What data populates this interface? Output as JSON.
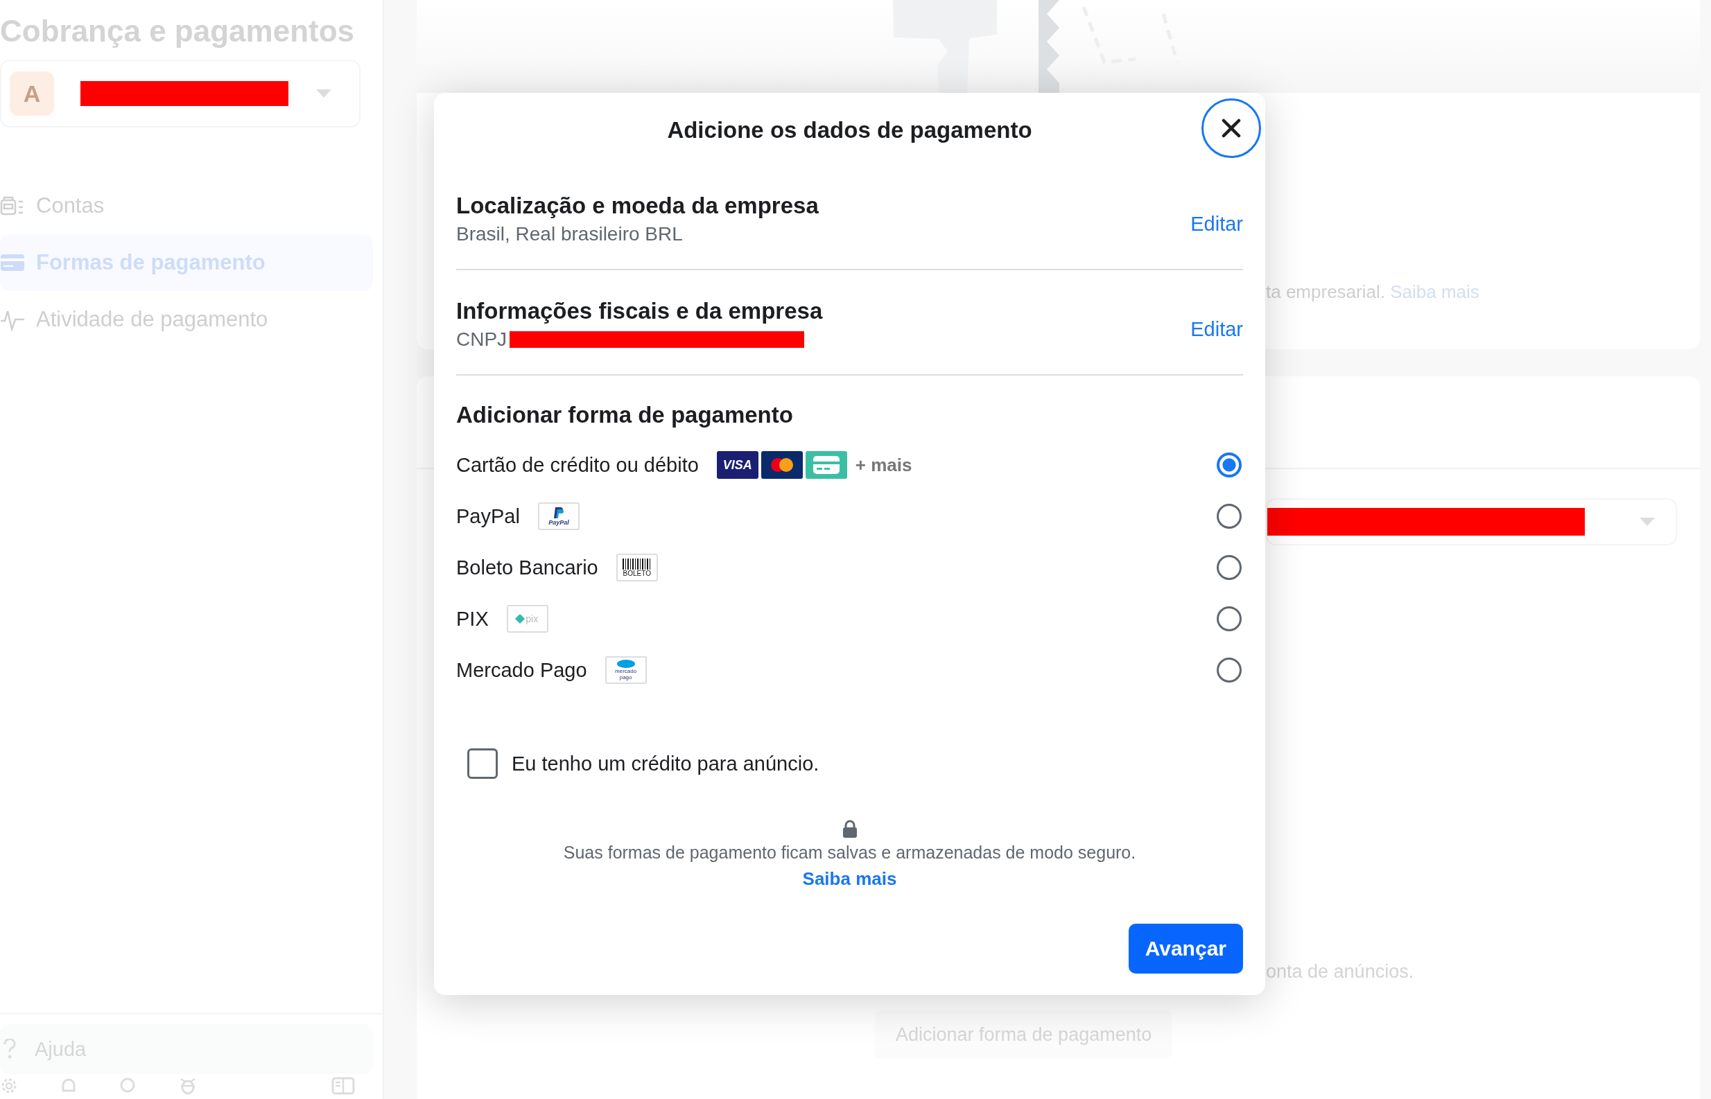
{
  "sidebar": {
    "title": "Cobrança e pagamentos",
    "account": {
      "avatar_letter": "A"
    },
    "nav_items": [
      {
        "kind": "accounts",
        "label": "Contas",
        "selected": false
      },
      {
        "kind": "card",
        "label": "Formas de pagamento",
        "selected": true
      },
      {
        "kind": "activity",
        "label": "Atividade de pagamento",
        "selected": false
      }
    ],
    "help": {
      "label": "Ajuda"
    }
  },
  "background": {
    "notice": {
      "text": "ta empresarial.",
      "link": "Saiba mais"
    },
    "footnote": "onta de anúncios.",
    "add_button": "Adicionar forma de pagamento"
  },
  "dialog": {
    "title": "Adicione os dados de pagamento",
    "sections": [
      {
        "heading": "Localização e moeda da empresa",
        "value": "Brasil, Real brasileiro BRL",
        "action": "Editar"
      },
      {
        "heading": "Informações fiscais e da empresa",
        "value": "CNPJ",
        "action": "Editar"
      }
    ],
    "payment": {
      "heading": "Adicionar forma de pagamento",
      "methods": [
        {
          "label": "Cartão de crédito ou débito",
          "logos": [
            {
              "kind": "visa",
              "text": "VISA"
            },
            {
              "kind": "mastercard"
            },
            {
              "kind": "card"
            }
          ],
          "more": "+ mais",
          "selected": true
        },
        {
          "label": "PayPal",
          "logos": [
            {
              "kind": "paypal",
              "text": "PayPal"
            }
          ],
          "selected": false
        },
        {
          "label": "Boleto Bancario",
          "logos": [
            {
              "kind": "boleto",
              "text": "BOLETO"
            }
          ],
          "selected": false
        },
        {
          "label": "PIX",
          "logos": [
            {
              "kind": "pix",
              "text": "pix"
            }
          ],
          "selected": false
        },
        {
          "label": "Mercado Pago",
          "logos": [
            {
              "kind": "mercadopago",
              "text": "mercado pago"
            }
          ],
          "selected": false
        }
      ]
    },
    "credit": {
      "label": "Eu tenho um crédito para anúncio.",
      "checked": false
    },
    "security": {
      "text": "Suas formas de pagamento ficam salvas e armazenadas de modo seguro.",
      "link": "Saiba mais"
    },
    "next_button": "Avançar"
  }
}
